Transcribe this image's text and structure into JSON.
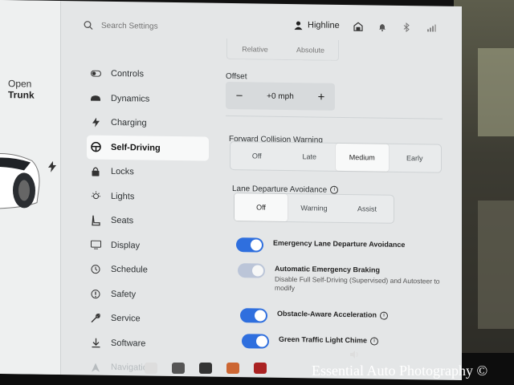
{
  "car": {
    "trunk_line1": "Open",
    "trunk_line2": "Trunk"
  },
  "search": {
    "placeholder": "Search Settings"
  },
  "profile": {
    "name": "Highline"
  },
  "nav": {
    "items": [
      {
        "label": "Controls",
        "icon": "toggle-icon"
      },
      {
        "label": "Dynamics",
        "icon": "car-icon"
      },
      {
        "label": "Charging",
        "icon": "bolt-icon"
      },
      {
        "label": "Self-Driving",
        "icon": "steering-wheel-icon"
      },
      {
        "label": "Locks",
        "icon": "lock-icon"
      },
      {
        "label": "Lights",
        "icon": "light-icon"
      },
      {
        "label": "Seats",
        "icon": "seat-icon"
      },
      {
        "label": "Display",
        "icon": "display-icon"
      },
      {
        "label": "Schedule",
        "icon": "clock-icon"
      },
      {
        "label": "Safety",
        "icon": "safety-icon"
      },
      {
        "label": "Service",
        "icon": "wrench-icon"
      },
      {
        "label": "Software",
        "icon": "download-icon"
      },
      {
        "label": "Navigation",
        "icon": "navigation-icon"
      }
    ],
    "active_index": 3
  },
  "speed_mode": {
    "options": [
      "Relative",
      "Absolute"
    ]
  },
  "offset": {
    "label": "Offset",
    "value": "+0 mph",
    "minus": "−",
    "plus": "+"
  },
  "fcw": {
    "label": "Forward Collision Warning",
    "options": [
      "Off",
      "Late",
      "Medium",
      "Early"
    ],
    "selected": "Medium"
  },
  "lda": {
    "label": "Lane Departure Avoidance",
    "options": [
      "Off",
      "Warning",
      "Assist"
    ],
    "selected": "Off"
  },
  "toggles": [
    {
      "label": "Emergency Lane Departure Avoidance",
      "on": true,
      "enabled": true
    },
    {
      "label": "Automatic Emergency Braking",
      "sub": "Disable Full Self-Driving (Supervised) and Autosteer to modify",
      "on": true,
      "enabled": false
    },
    {
      "label": "Obstacle-Aware Acceleration",
      "on": true,
      "enabled": true,
      "info": true
    },
    {
      "label": "Green Traffic Light Chime",
      "on": true,
      "enabled": true,
      "info": true
    }
  ],
  "watermark": "Essential Auto Photography ©",
  "colors": {
    "accent": "#2f6fde",
    "screen_bg": "#e4e6e7",
    "active_nav_bg": "#f8f9f9"
  }
}
